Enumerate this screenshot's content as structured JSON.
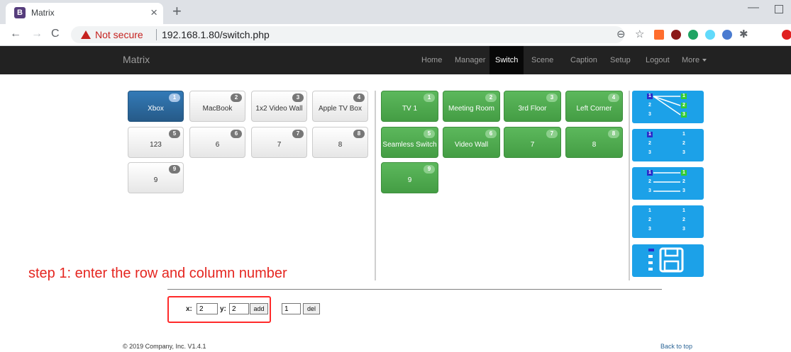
{
  "browser": {
    "tab_title": "Matrix",
    "favicon": "B",
    "close_glyph": "×",
    "new_tab_glyph": "+",
    "security_label": "Not secure",
    "url": "192.168.1.80/switch.php"
  },
  "navbar": {
    "brand": "Matrix",
    "items": [
      {
        "label": "Home"
      },
      {
        "label": "Manager"
      },
      {
        "label": "Switch",
        "active": true
      },
      {
        "label": "Scene"
      },
      {
        "label": "Caption"
      },
      {
        "label": "Setup"
      },
      {
        "label": "Logout"
      },
      {
        "label": "More"
      }
    ]
  },
  "sources": [
    {
      "num": "1",
      "label": "Xbox",
      "selected": true
    },
    {
      "num": "2",
      "label": "MacBook"
    },
    {
      "num": "3",
      "label": "1x2 Video Wall"
    },
    {
      "num": "4",
      "label": "Apple TV Box"
    },
    {
      "num": "5",
      "label": "123"
    },
    {
      "num": "6",
      "label": "6"
    },
    {
      "num": "7",
      "label": "7"
    },
    {
      "num": "8",
      "label": "8"
    },
    {
      "num": "9",
      "label": "9"
    }
  ],
  "displays": [
    {
      "num": "1",
      "label": "TV 1"
    },
    {
      "num": "2",
      "label": "Meeting Room"
    },
    {
      "num": "3",
      "label": "3rd Floor"
    },
    {
      "num": "4",
      "label": "Left Corner"
    },
    {
      "num": "5",
      "label": "Seamless Switch"
    },
    {
      "num": "6",
      "label": "Video Wall"
    },
    {
      "num": "7",
      "label": "7"
    },
    {
      "num": "8",
      "label": "8"
    },
    {
      "num": "9",
      "label": "9"
    }
  ],
  "presets": {
    "numbers": [
      "1",
      "2",
      "3"
    ],
    "modes": [
      "one-to-all",
      "none",
      "one-to-one",
      "none"
    ]
  },
  "annotation": "step 1: enter the row and column number",
  "form": {
    "x_label": "x:",
    "x_value": "2",
    "y_label": "y:",
    "y_value": "2",
    "add_label": "add",
    "del_value": "1",
    "del_label": "del"
  },
  "footer": {
    "copyright": "© 2019 Company, Inc. V1.4.1",
    "back_to_top": "Back to top"
  },
  "colors": {
    "source_selected": "#337ab7",
    "display": "#5cb85c",
    "preset": "#1ca1e8",
    "annotation": "#e52620"
  }
}
